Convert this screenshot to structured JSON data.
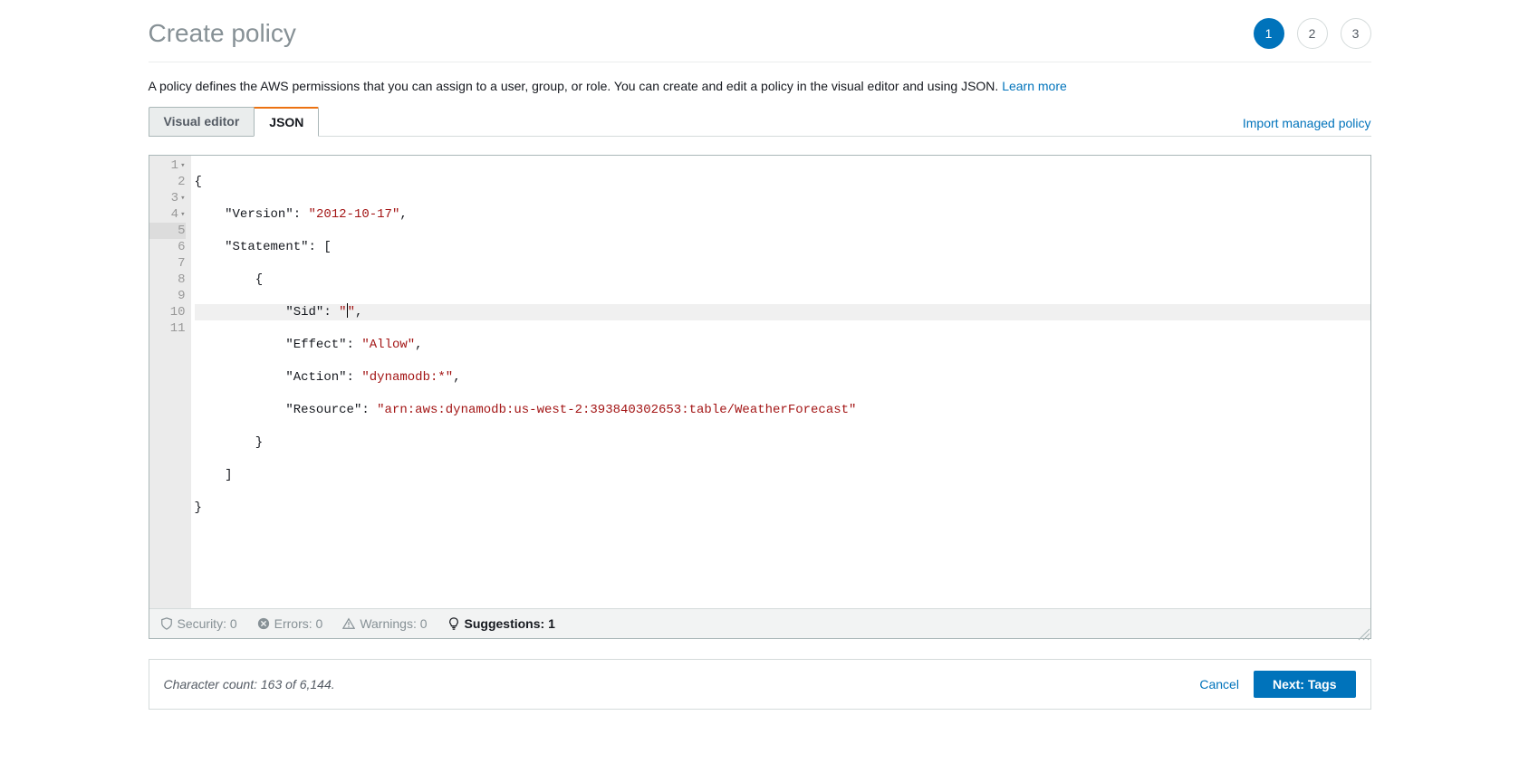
{
  "header": {
    "title": "Create policy",
    "steps": [
      "1",
      "2",
      "3"
    ],
    "active_step_index": 0
  },
  "description": {
    "text": "A policy defines the AWS permissions that you can assign to a user, group, or role. You can create and edit a policy in the visual editor and using JSON. ",
    "learn_more": "Learn more"
  },
  "tabs": {
    "visual_editor": "Visual editor",
    "json": "JSON",
    "import_link": "Import managed policy"
  },
  "editor": {
    "line_numbers": [
      "1",
      "2",
      "3",
      "4",
      "5",
      "6",
      "7",
      "8",
      "9",
      "10",
      "11"
    ],
    "policy": {
      "Version": "2012-10-17",
      "Statement": [
        {
          "Sid": "",
          "Effect": "Allow",
          "Action": "dynamodb:*",
          "Resource": "arn:aws:dynamodb:us-west-2:393840302653:table/WeatherForecast"
        }
      ]
    },
    "tokens": {
      "version_key": "\"Version\"",
      "version_val": "\"2012-10-17\"",
      "statement_key": "\"Statement\"",
      "sid_key": "\"Sid\"",
      "sid_val_open": "\"",
      "sid_val_close": "\"",
      "effect_key": "\"Effect\"",
      "effect_val": "\"Allow\"",
      "action_key": "\"Action\"",
      "action_val": "\"dynamodb:*\"",
      "resource_key": "\"Resource\"",
      "resource_val": "\"arn:aws:dynamodb:us-west-2:393840302653:table/WeatherForecast\""
    }
  },
  "status_bar": {
    "security": "Security: 0",
    "errors": "Errors: 0",
    "warnings": "Warnings: 0",
    "suggestions": "Suggestions: 1"
  },
  "footer": {
    "char_count": "Character count: 163 of 6,144.",
    "cancel": "Cancel",
    "next": "Next: Tags"
  }
}
